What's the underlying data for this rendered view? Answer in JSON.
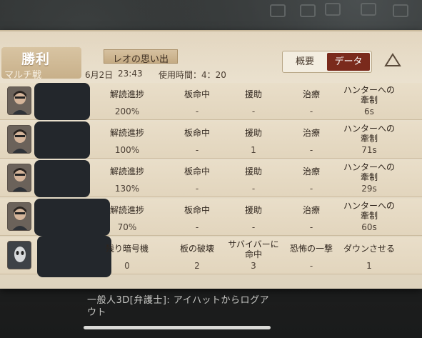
{
  "header": {
    "result": "勝利",
    "mode": "マルチ戦",
    "map_name": "レオの思い出",
    "date": "6月2日",
    "time": "23:43",
    "duration": "使用時間：4：20"
  },
  "tabs": {
    "overview": "概要",
    "data": "データ",
    "active": "data"
  },
  "survivor_columns": [
    "解読進捗",
    "板命中",
    "援助",
    "治療",
    "ハンターへの\n牽制"
  ],
  "hunter_columns": [
    "残り暗号機",
    "板の破壊",
    "サバイバーに\n命中",
    "恐怖の一撃",
    "ダウンさせる"
  ],
  "rows": [
    {
      "role": "survivor",
      "values": [
        "200%",
        "-",
        "-",
        "-",
        "6s"
      ]
    },
    {
      "role": "survivor",
      "values": [
        "100%",
        "-",
        "1",
        "-",
        "71s"
      ]
    },
    {
      "role": "survivor",
      "values": [
        "130%",
        "-",
        "-",
        "-",
        "29s"
      ]
    },
    {
      "role": "survivor",
      "values": [
        "70%",
        "-",
        "-",
        "-",
        "60s"
      ]
    },
    {
      "role": "hunter",
      "values": [
        "0",
        "2",
        "3",
        "-",
        "1"
      ]
    }
  ],
  "background_text": "一般人3D[弁護士]: アイハットからログアウト",
  "colors": {
    "parchment": "#e6dcc8",
    "active_tab": "#7a2a1c",
    "name_block": "#23272c"
  }
}
